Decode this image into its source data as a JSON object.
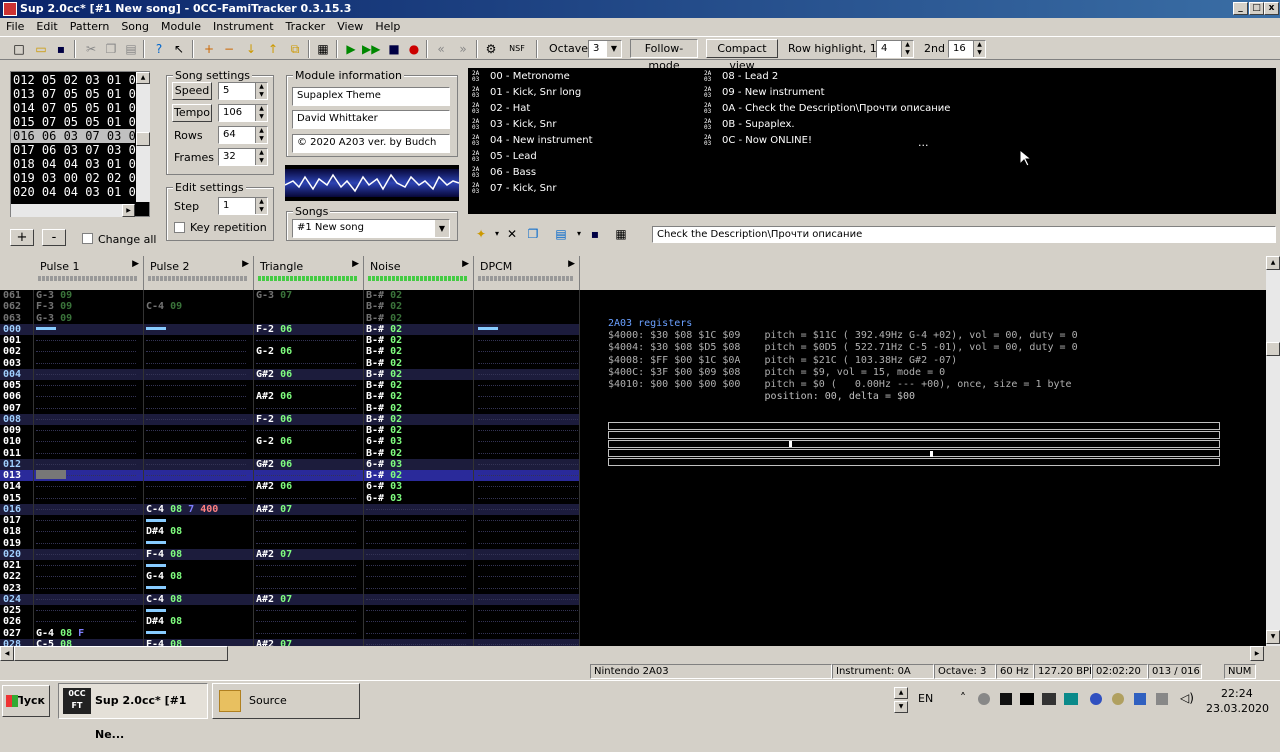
{
  "window": {
    "title": "Sup 2.0cc* [#1 New song] - 0CC-FamiTracker 0.3.15.3"
  },
  "menu": [
    "File",
    "Edit",
    "Pattern",
    "Song",
    "Module",
    "Instrument",
    "Tracker",
    "View",
    "Help"
  ],
  "toolbar": {
    "octave_label": "Octave",
    "octave_value": "3",
    "follow_mode": "Follow-mode",
    "compact_view": "Compact view",
    "row_highlight_label": "Row highlight, 1st",
    "row_highlight_1st": "4",
    "row_highlight_2nd_label": "2nd",
    "row_highlight_2nd": "16"
  },
  "orders": {
    "rows": [
      "012 05 02 03 01 00",
      "013 07 05 05 01 00",
      "014 07 05 05 01 00",
      "015 07 05 05 01 00",
      "016 06 03 07 03 00",
      "017 06 03 07 03 00",
      "018 04 04 03 01 00",
      "019 03 00 02 02 00",
      "020 04 04 03 01 00"
    ],
    "selected": 4,
    "add": "+",
    "remove": "-",
    "change_all": "Change all"
  },
  "song_settings": {
    "title": "Song settings",
    "speed_label": "Speed",
    "speed": "5",
    "tempo_label": "Tempo",
    "tempo": "106",
    "rows_label": "Rows",
    "rows": "64",
    "frames_label": "Frames",
    "frames": "32"
  },
  "edit_settings": {
    "title": "Edit settings",
    "step_label": "Step",
    "step": "1",
    "key_repetition": "Key repetition"
  },
  "module_info": {
    "title": "Module information",
    "name": "Supaplex Theme",
    "artist": "David Whittaker",
    "copyright": "© 2020 A203 ver. by Budch"
  },
  "songs": {
    "title": "Songs",
    "selected": "#1 New song"
  },
  "instruments": {
    "col1": [
      "00 - Metronome",
      "01 - Kick, Snr long",
      "02 - Hat",
      "03 - Kick, Snr",
      "04 - New instrument",
      "05 - Lead",
      "06 - Bass",
      "07 - Kick, Snr"
    ],
    "col2": [
      "08 - Lead 2",
      "09 - New instrument",
      "0A - Check the Description\\Прочти описание",
      "0B - Supaplex.",
      "0C - Now ONLINE!"
    ],
    "ellipsis": "...",
    "icon_text": "2A\n03",
    "name_field": "Check the Description\\Прочти описание"
  },
  "channels": [
    "Pulse 1",
    "Pulse 2",
    "Triangle",
    "Noise",
    "DPCM"
  ],
  "pattern": {
    "prev": [
      {
        "n": "061",
        "c": [
          "G-3 09",
          "",
          "G-3 07",
          "B-# 02",
          ""
        ]
      },
      {
        "n": "062",
        "c": [
          "F-3 09",
          "C-4 09",
          "",
          "B-# 02",
          ""
        ]
      },
      {
        "n": "063",
        "c": [
          "G-3 09",
          "",
          "",
          "B-# 02",
          ""
        ]
      }
    ],
    "rows": [
      {
        "n": "000",
        "c": [
          "===",
          "===",
          "F-2 06",
          "B-# 02",
          "==="
        ]
      },
      {
        "n": "001",
        "c": [
          "",
          "",
          "",
          "B-# 02",
          ""
        ]
      },
      {
        "n": "002",
        "c": [
          "",
          "",
          "G-2 06",
          "B-# 02",
          ""
        ]
      },
      {
        "n": "003",
        "c": [
          "",
          "",
          "",
          "B-# 02",
          ""
        ]
      },
      {
        "n": "004",
        "c": [
          "",
          "",
          "G#2 06",
          "B-# 02",
          ""
        ]
      },
      {
        "n": "005",
        "c": [
          "",
          "",
          "",
          "B-# 02",
          ""
        ]
      },
      {
        "n": "006",
        "c": [
          "",
          "",
          "A#2 06",
          "B-# 02",
          ""
        ]
      },
      {
        "n": "007",
        "c": [
          "",
          "",
          "",
          "B-# 02",
          ""
        ]
      },
      {
        "n": "008",
        "c": [
          "",
          "",
          "F-2 06",
          "B-# 02",
          ""
        ]
      },
      {
        "n": "009",
        "c": [
          "",
          "",
          "",
          "B-# 02",
          ""
        ]
      },
      {
        "n": "010",
        "c": [
          "",
          "",
          "G-2 06",
          "6-# 03",
          ""
        ]
      },
      {
        "n": "011",
        "c": [
          "",
          "",
          "",
          "B-# 02",
          ""
        ]
      },
      {
        "n": "012",
        "c": [
          "",
          "",
          "G#2 06",
          "6-# 03",
          ""
        ]
      },
      {
        "n": "013",
        "c": [
          "",
          "",
          "",
          "B-# 02",
          ""
        ]
      },
      {
        "n": "014",
        "c": [
          "",
          "",
          "A#2 06",
          "6-# 03",
          ""
        ]
      },
      {
        "n": "015",
        "c": [
          "",
          "",
          "",
          "6-# 03",
          ""
        ]
      },
      {
        "n": "016",
        "c": [
          "",
          "C-4 08 7 400",
          "A#2 07",
          "",
          ""
        ]
      },
      {
        "n": "017",
        "c": [
          "",
          "===",
          "",
          "",
          ""
        ]
      },
      {
        "n": "018",
        "c": [
          "",
          "D#4 08",
          "",
          "",
          ""
        ]
      },
      {
        "n": "019",
        "c": [
          "",
          "===",
          "",
          "",
          ""
        ]
      },
      {
        "n": "020",
        "c": [
          "",
          "F-4 08",
          "A#2 07",
          "",
          ""
        ]
      },
      {
        "n": "021",
        "c": [
          "",
          "===",
          "",
          "",
          ""
        ]
      },
      {
        "n": "022",
        "c": [
          "",
          "G-4 08",
          "",
          "",
          ""
        ]
      },
      {
        "n": "023",
        "c": [
          "",
          "===",
          "",
          "",
          ""
        ]
      },
      {
        "n": "024",
        "c": [
          "",
          "C-4 08",
          "A#2 07",
          "",
          ""
        ]
      },
      {
        "n": "025",
        "c": [
          "",
          "===",
          "",
          "",
          ""
        ]
      },
      {
        "n": "026",
        "c": [
          "",
          "D#4 08",
          "",
          "",
          ""
        ]
      },
      {
        "n": "027",
        "c": [
          "G-4 08 F",
          "===",
          "",
          "",
          ""
        ]
      },
      {
        "n": "028",
        "c": [
          "C-5 08",
          "F-4 08",
          "A#2 07",
          "",
          ""
        ]
      }
    ],
    "cursor_row": 13
  },
  "registers": {
    "title": "2A03 registers",
    "lines": [
      "$4000: $30 $08 $1C $09    pitch = $11C ( 392.49Hz G-4 +02), vol = 00, duty = 0",
      "$4004: $30 $08 $D5 $08    pitch = $0D5 ( 522.71Hz C-5 -01), vol = 00, duty = 0",
      "$4008: $FF $00 $1C $0A    pitch = $21C ( 103.38Hz G#2 -07)",
      "$400C: $3F $00 $09 $08    pitch = $9, vol = 15, mode = 0",
      "$4010: $00 $00 $00 $00    pitch = $0 (   0.00Hz --- +00), once, size = 1 byte",
      "                          position: 00, delta = $00"
    ]
  },
  "status": {
    "chip": "Nintendo 2A03",
    "instrument": "Instrument: 0A",
    "octave": "Octave: 3",
    "rate": "60 Hz",
    "bpm": "127.20 BPM",
    "time": "02:02:20",
    "position": "013 / 016",
    "num": "NUM"
  },
  "taskbar": {
    "start": "Пуск",
    "app": "Sup 2.0cc* [#1 Ne...",
    "app_icon": "0CC FT",
    "folder": "Source",
    "lang": "EN",
    "time": "22:24",
    "date": "23.03.2020"
  },
  "colors": {
    "note": "#ffffff",
    "instrument_num": "#80ff80",
    "row_highlight": "#1c1c3c",
    "cursor_row": "#2a2a9a",
    "register_value": "#e0a040"
  }
}
